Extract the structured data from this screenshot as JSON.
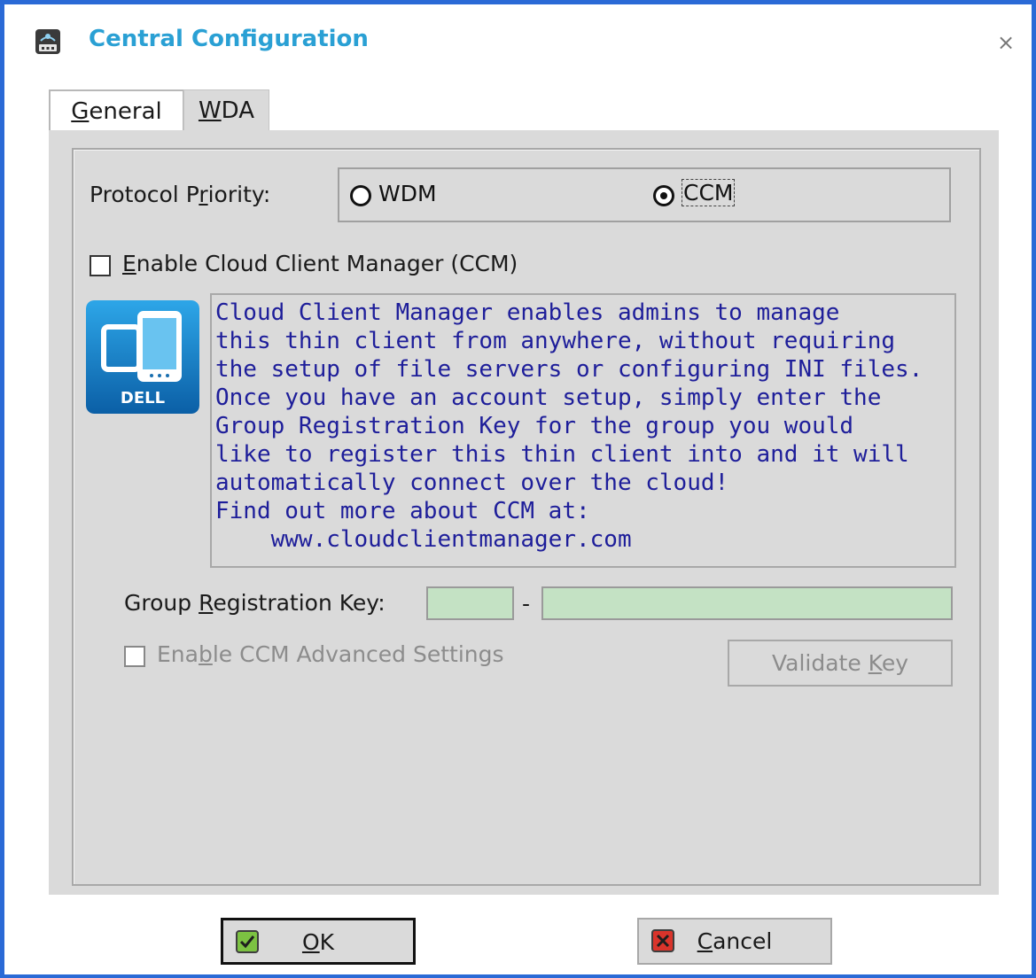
{
  "window": {
    "title": "Central Configuration",
    "close_symbol": "×",
    "icon": "network-icon"
  },
  "tabs": [
    {
      "label": "General",
      "mnemonic": "G",
      "rest": "eneral",
      "selected": false
    },
    {
      "label": "WDA",
      "mnemonic": "W",
      "rest": "DA",
      "selected": true
    }
  ],
  "protocol_priority": {
    "label_pre": "Protocol P",
    "label_mnemonic": "r",
    "label_post": "iority:",
    "options": [
      {
        "label": "WDM",
        "selected": false
      },
      {
        "label": "CCM",
        "selected": true
      }
    ]
  },
  "enable_ccm": {
    "mnemonic": "E",
    "rest": "nable Cloud Client Manager (CCM)",
    "checked": false
  },
  "logo": {
    "text": "DELL",
    "icon": "devices-icon"
  },
  "info_lines": [
    "Cloud Client Manager enables admins to manage",
    "this thin client from anywhere, without requiring",
    "the setup of file servers or configuring INI files.",
    "Once you have an account setup, simply enter the",
    "Group Registration Key for the group you would",
    "like to register this thin client into and it will",
    "automatically connect over the cloud!",
    "Find out more about CCM at:",
    "    www.cloudclientmanager.com"
  ],
  "group_key": {
    "label_pre": "Group ",
    "label_mnemonic": "R",
    "label_post": "egistration Key:",
    "separator": "-",
    "part1": "",
    "part2": ""
  },
  "advanced": {
    "label_pre": "Ena",
    "label_mnemonic": "b",
    "label_post": "le CCM Advanced Settings",
    "checked": false,
    "enabled": false
  },
  "validate": {
    "pre": "Validate ",
    "mnemonic": "K",
    "post": "ey",
    "enabled": false
  },
  "ok": {
    "mnemonic": "O",
    "rest": "K",
    "icon": "checkmark-icon",
    "icon_color": "#7cc242"
  },
  "cancel": {
    "mnemonic": "C",
    "rest": "ancel",
    "icon": "x-icon",
    "icon_color": "#d9342b"
  }
}
